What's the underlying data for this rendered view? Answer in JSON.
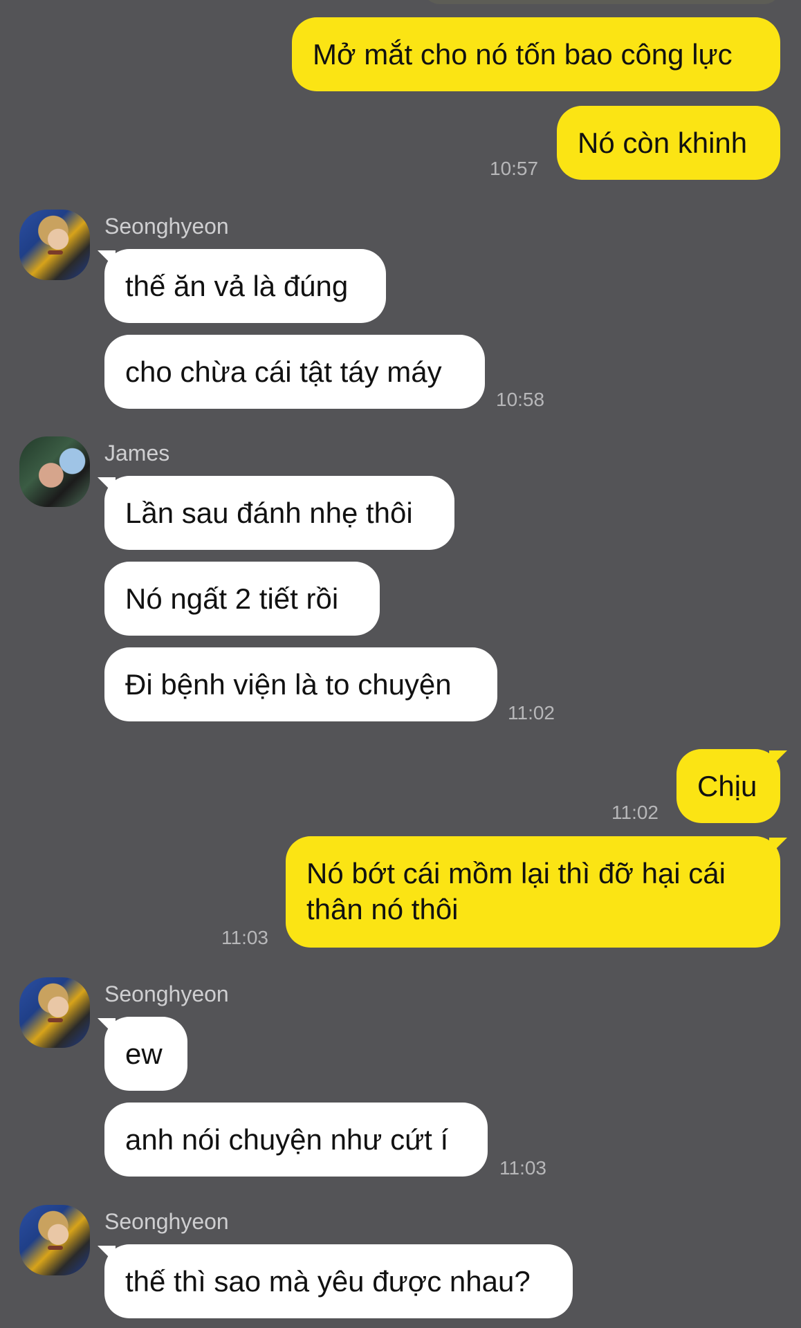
{
  "messages": {
    "m1": "Mở mắt cho nó tốn bao công lực",
    "m2": "Nó còn khinh",
    "t1": "10:57",
    "seong1_name": "Seonghyeon",
    "m3": "thế ăn vả là đúng",
    "m4": "cho chừa cái tật táy máy",
    "t2": "10:58",
    "james_name": "James",
    "m5": "Lần sau đánh nhẹ thôi",
    "m6": "Nó ngất 2 tiết rồi",
    "m7": "Đi bệnh viện là to chuyện",
    "t3": "11:02",
    "m8": "Chịu",
    "t4": "11:02",
    "m9": "Nó bớt cái mồm lại thì đỡ hại cái thân nó thôi",
    "t5": "11:03",
    "seong2_name": "Seonghyeon",
    "m10": "ew",
    "m11": "anh nói chuyện như cứt í",
    "t6": "11:03",
    "seong3_name": "Seonghyeon",
    "m12": "thế thì sao mà yêu được nhau?"
  },
  "colors": {
    "background": "#545457",
    "outgoing": "#fbe414",
    "incoming": "#ffffff",
    "timestamp": "#b7b7b9"
  },
  "avatars": {
    "seonghyeon": "avatar-seonghyeon",
    "james": "avatar-james"
  }
}
